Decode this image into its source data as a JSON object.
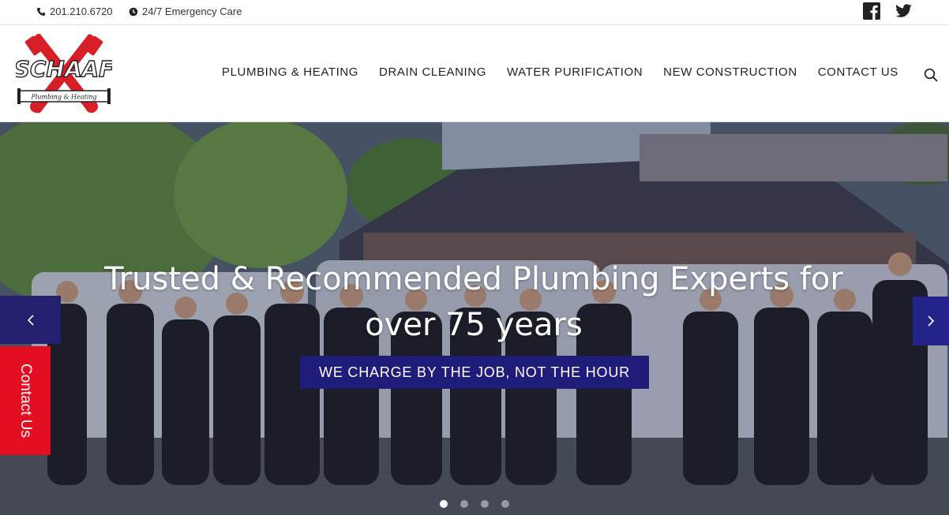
{
  "topbar": {
    "phone_icon": "phone-icon",
    "phone": "201.210.6720",
    "clock_icon": "clock-icon",
    "care": "24/7 Emergency Care",
    "social": [
      "facebook-icon",
      "twitter-icon"
    ]
  },
  "header": {
    "logo_text": "SCHAAF",
    "logo_sub": "Plumbing & Heating",
    "nav": [
      "PLUMBING & HEATING",
      "DRAIN CLEANING",
      "WATER PURIFICATION",
      "NEW CONSTRUCTION",
      "CONTACT US"
    ],
    "search_icon": "search-icon"
  },
  "hero": {
    "headline_line1": "Trusted & Recommended Plumbing Experts for",
    "headline_line2": "over 75 years",
    "tagline": "WE CHARGE BY THE JOB, NOT THE HOUR",
    "contact_tab": "Contact Us",
    "slides_total": 4,
    "active_slide": 1
  },
  "colors": {
    "brand_red": "#e30e21",
    "brand_navy": "#1f1c7a"
  }
}
